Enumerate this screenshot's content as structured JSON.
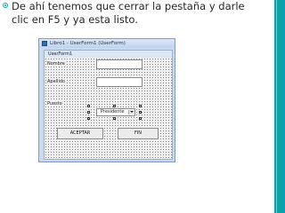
{
  "slide": {
    "text": "De ahí tenemos que cerrar la pestaña y darle clic en F5 y ya esta listo."
  },
  "window": {
    "title": "Libro1 - UserForm1 (UserForm)"
  },
  "form": {
    "caption": "UserForm1",
    "labels": {
      "nombre": "Nombre",
      "apellido": "Apellido",
      "puesto": "Puesto"
    },
    "combo_value": "Presidente",
    "buttons": {
      "aceptar": "ACEPTAR",
      "fin": "FIN"
    }
  },
  "colors": {
    "accent": "#0aa3ad"
  }
}
